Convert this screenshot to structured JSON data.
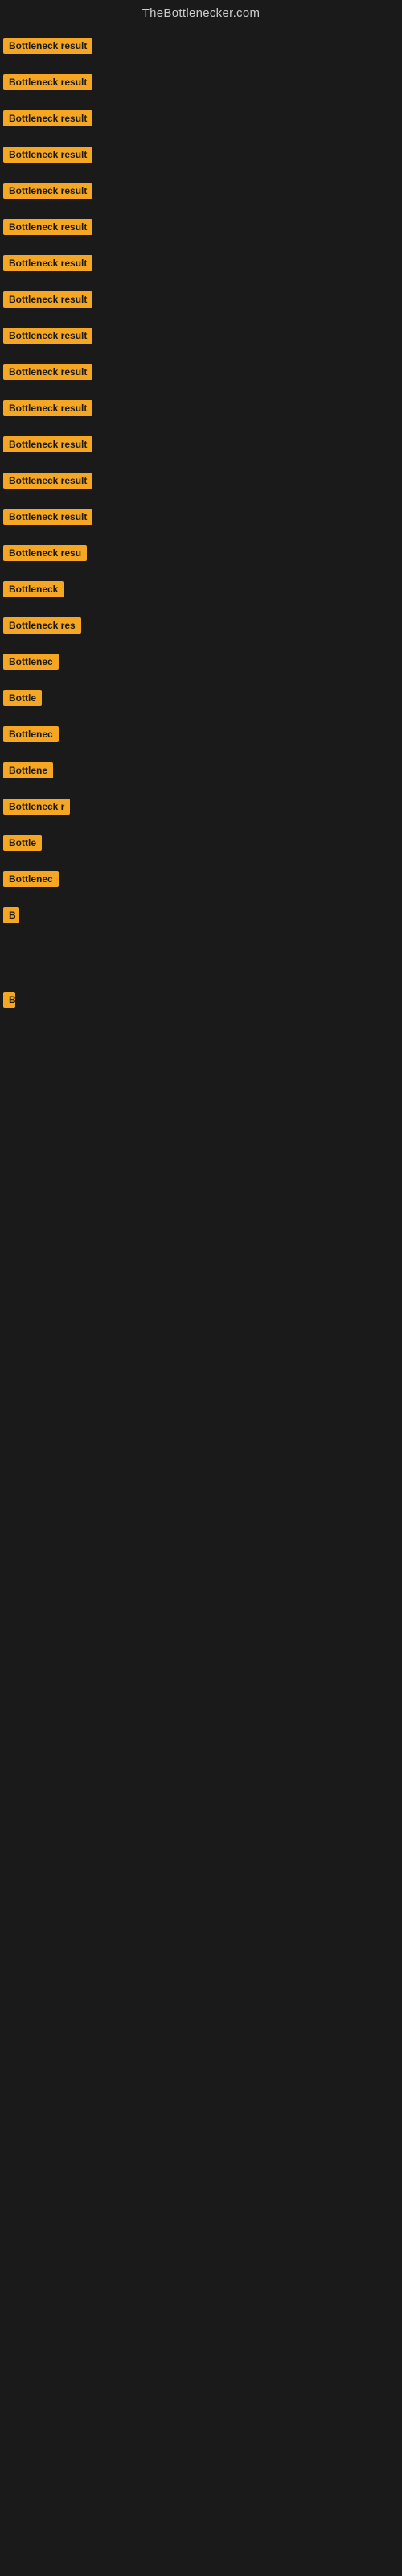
{
  "header": {
    "title": "TheBottlenecker.com"
  },
  "items": [
    {
      "id": 1,
      "label": "Bottleneck result",
      "size_class": "item-full"
    },
    {
      "id": 2,
      "label": "Bottleneck result",
      "size_class": "item-full"
    },
    {
      "id": 3,
      "label": "Bottleneck result",
      "size_class": "item-full"
    },
    {
      "id": 4,
      "label": "Bottleneck result",
      "size_class": "item-full"
    },
    {
      "id": 5,
      "label": "Bottleneck result",
      "size_class": "item-full"
    },
    {
      "id": 6,
      "label": "Bottleneck result",
      "size_class": "item-full"
    },
    {
      "id": 7,
      "label": "Bottleneck result",
      "size_class": "item-full"
    },
    {
      "id": 8,
      "label": "Bottleneck result",
      "size_class": "item-full"
    },
    {
      "id": 9,
      "label": "Bottleneck result",
      "size_class": "item-full"
    },
    {
      "id": 10,
      "label": "Bottleneck result",
      "size_class": "item-full"
    },
    {
      "id": 11,
      "label": "Bottleneck result",
      "size_class": "item-full"
    },
    {
      "id": 12,
      "label": "Bottleneck result",
      "size_class": "item-full"
    },
    {
      "id": 13,
      "label": "Bottleneck result",
      "size_class": "item-full"
    },
    {
      "id": 14,
      "label": "Bottleneck result",
      "size_class": "item-full"
    },
    {
      "id": 15,
      "label": "Bottleneck resu",
      "size_class": "item-lg"
    },
    {
      "id": 16,
      "label": "Bottleneck",
      "size_class": "item-sm2"
    },
    {
      "id": 17,
      "label": "Bottleneck res",
      "size_class": "item-md2"
    },
    {
      "id": 18,
      "label": "Bottlenec",
      "size_class": "item-xs2"
    },
    {
      "id": 19,
      "label": "Bottle",
      "size_class": "item-xs"
    },
    {
      "id": 20,
      "label": "Bottlenec",
      "size_class": "item-xs2"
    },
    {
      "id": 21,
      "label": "Bottlene",
      "size_class": "item-xxs"
    },
    {
      "id": 22,
      "label": "Bottleneck r",
      "size_class": "item-sm"
    },
    {
      "id": 23,
      "label": "Bottle",
      "size_class": "item-xs"
    },
    {
      "id": 24,
      "label": "Bottlenec",
      "size_class": "item-xs2"
    },
    {
      "id": 25,
      "label": "B",
      "size_class": "item-pico"
    },
    {
      "id": 26,
      "label": "",
      "size_class": "item-nano"
    },
    {
      "id": 27,
      "label": "",
      "size_class": "item-nano"
    },
    {
      "id": 28,
      "label": "",
      "size_class": "item-nano"
    },
    {
      "id": 29,
      "label": "B",
      "size_class": "item-tiny"
    },
    {
      "id": 30,
      "label": "",
      "size_class": "item-nano"
    },
    {
      "id": 31,
      "label": "",
      "size_class": "item-nano"
    },
    {
      "id": 32,
      "label": "",
      "size_class": "item-nano"
    }
  ]
}
